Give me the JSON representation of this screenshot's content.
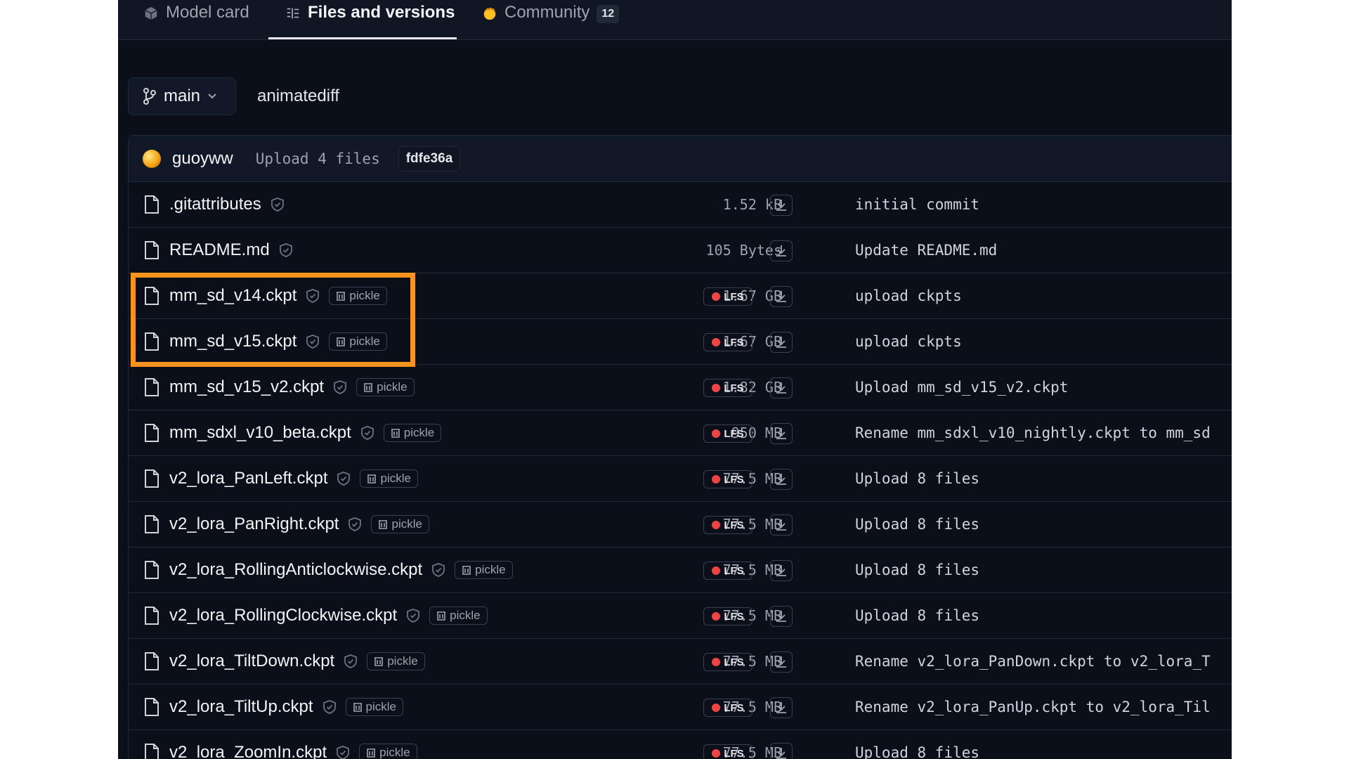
{
  "tabs": [
    {
      "label": "Model card",
      "icon": "cube-icon",
      "active": false
    },
    {
      "label": "Files and versions",
      "icon": "files-icon",
      "active": true
    },
    {
      "label": "Community",
      "icon": "hand-icon",
      "active": false,
      "badge": "12"
    }
  ],
  "branch": {
    "name": "main",
    "path": "animatediff"
  },
  "commit": {
    "user": "guoyww",
    "message": "Upload 4 files",
    "hash": "fdfe36a"
  },
  "files": [
    {
      "name": ".gitattributes",
      "size": "1.52 kB",
      "lfs": false,
      "pickle": false,
      "message": "initial commit"
    },
    {
      "name": "README.md",
      "size": "105 Bytes",
      "lfs": false,
      "pickle": false,
      "message": "Update README.md"
    },
    {
      "name": "mm_sd_v14.ckpt",
      "size": "1.67 GB",
      "lfs": true,
      "pickle": true,
      "message": "upload ckpts"
    },
    {
      "name": "mm_sd_v15.ckpt",
      "size": "1.67 GB",
      "lfs": true,
      "pickle": true,
      "message": "upload ckpts"
    },
    {
      "name": "mm_sd_v15_v2.ckpt",
      "size": "1.82 GB",
      "lfs": true,
      "pickle": true,
      "message": "Upload mm_sd_v15_v2.ckpt"
    },
    {
      "name": "mm_sdxl_v10_beta.ckpt",
      "size": "950 MB",
      "lfs": true,
      "pickle": true,
      "message": "Rename mm_sdxl_v10_nightly.ckpt to mm_sd"
    },
    {
      "name": "v2_lora_PanLeft.ckpt",
      "size": "77.5 MB",
      "lfs": true,
      "pickle": true,
      "message": "Upload 8 files"
    },
    {
      "name": "v2_lora_PanRight.ckpt",
      "size": "77.5 MB",
      "lfs": true,
      "pickle": true,
      "message": "Upload 8 files"
    },
    {
      "name": "v2_lora_RollingAnticlockwise.ckpt",
      "size": "77.5 MB",
      "lfs": true,
      "pickle": true,
      "message": "Upload 8 files"
    },
    {
      "name": "v2_lora_RollingClockwise.ckpt",
      "size": "77.5 MB",
      "lfs": true,
      "pickle": true,
      "message": "Upload 8 files"
    },
    {
      "name": "v2_lora_TiltDown.ckpt",
      "size": "77.5 MB",
      "lfs": true,
      "pickle": true,
      "message": "Rename v2_lora_PanDown.ckpt to v2_lora_T"
    },
    {
      "name": "v2_lora_TiltUp.ckpt",
      "size": "77.5 MB",
      "lfs": true,
      "pickle": true,
      "message": "Rename v2_lora_PanUp.ckpt to v2_lora_Til"
    },
    {
      "name": "v2_lora_ZoomIn.ckpt",
      "size": "77.5 MB",
      "lfs": true,
      "pickle": true,
      "message": "Upload 8 files"
    }
  ],
  "labels": {
    "pickle": "pickle",
    "lfs": "LFS"
  },
  "colors": {
    "highlight": "#f7931e",
    "lfs_dot": "#ef4444",
    "background": "#0b0f19"
  }
}
